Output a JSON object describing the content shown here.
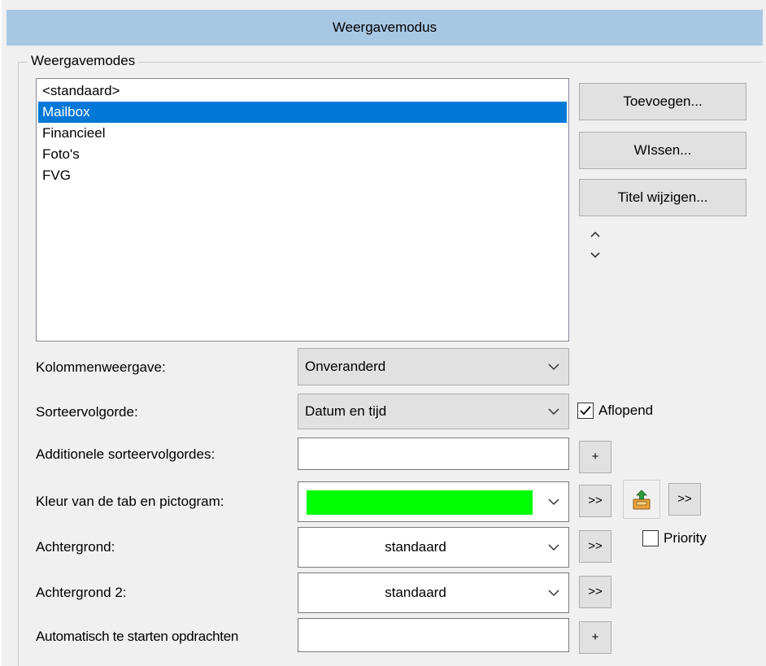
{
  "window": {
    "title": "Weergavemodus"
  },
  "group": {
    "legend": "Weergavemodes",
    "items": [
      {
        "label": "<standaard>",
        "selected": false
      },
      {
        "label": "Mailbox",
        "selected": true
      },
      {
        "label": "Financieel",
        "selected": false
      },
      {
        "label": "Foto's",
        "selected": false
      },
      {
        "label": "FVG",
        "selected": false
      }
    ]
  },
  "buttons": {
    "add": "Toevoegen...",
    "delete": "WIssen...",
    "rename": "Titel wijzigen...",
    "move_up_icon": "caret-up-icon",
    "move_down_icon": "caret-down-icon"
  },
  "form": {
    "columns": {
      "label": "Kolommenweergave:",
      "value": "Onveranderd"
    },
    "sort": {
      "label": "Sorteervolgorde:",
      "value": "Datum en tijd",
      "descending_label": "Aflopend",
      "descending_checked": true
    },
    "additional_sort": {
      "label": "Additionele sorteervolgordes:",
      "value": "",
      "button": "+"
    },
    "tab_color": {
      "label": "Kleur van de tab en pictogram:",
      "color": "#00ff00",
      "button": ">>",
      "icon_button": ">>",
      "icon": "inbox-tray-icon"
    },
    "priority": {
      "label": "Priority",
      "checked": false
    },
    "background": {
      "label": "Achtergrond:",
      "value": "standaard",
      "button": ">>"
    },
    "background2": {
      "label": "Achtergrond 2:",
      "value": "standaard",
      "button": ">>"
    },
    "autostart": {
      "label": "Automatisch te starten opdrachten",
      "value": "",
      "button": "+"
    }
  },
  "colors": {
    "title_bar": "#a8c7e3",
    "selection": "#0078d7",
    "swatch": "#00ff00"
  }
}
